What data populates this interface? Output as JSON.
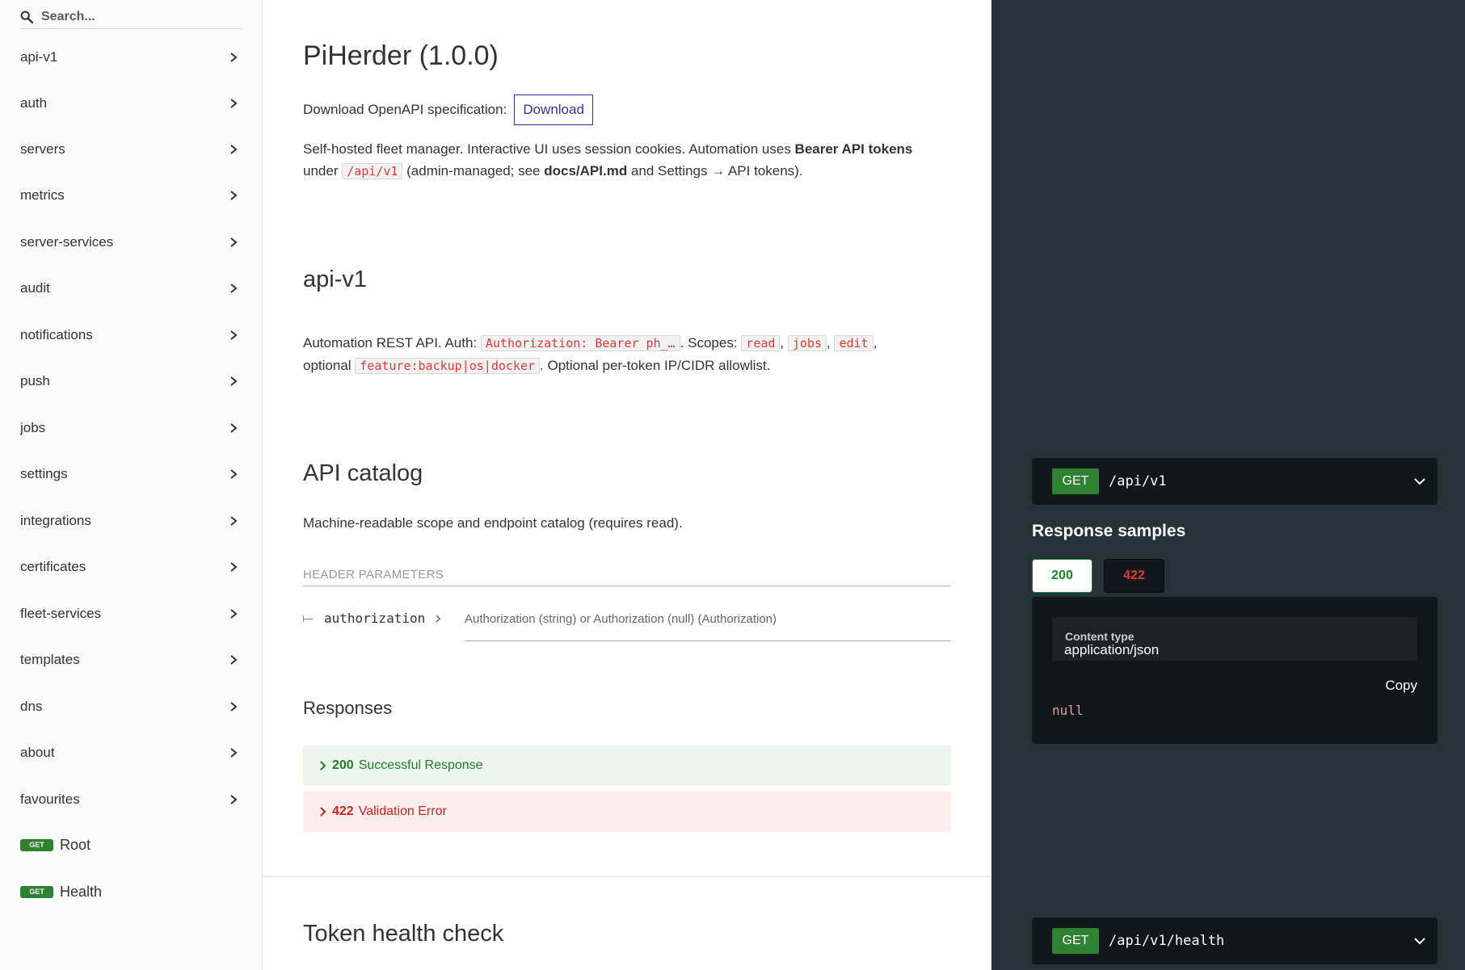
{
  "sidebar": {
    "search_placeholder": "Search...",
    "groups": [
      {
        "label": "api-v1"
      },
      {
        "label": "auth"
      },
      {
        "label": "servers"
      },
      {
        "label": "metrics"
      },
      {
        "label": "server-services"
      },
      {
        "label": "audit"
      },
      {
        "label": "notifications"
      },
      {
        "label": "push"
      },
      {
        "label": "jobs"
      },
      {
        "label": "settings"
      },
      {
        "label": "integrations"
      },
      {
        "label": "certificates"
      },
      {
        "label": "fleet-services"
      },
      {
        "label": "templates"
      },
      {
        "label": "dns"
      },
      {
        "label": "about"
      },
      {
        "label": "favourites"
      }
    ],
    "operations": [
      {
        "method": "GET",
        "label": "Root"
      },
      {
        "method": "GET",
        "label": "Health"
      }
    ]
  },
  "main": {
    "title": "PiHerder (1.0.0)",
    "download_label": "Download OpenAPI specification:",
    "download_button": "Download",
    "intro": {
      "t1": "Self-hosted fleet manager. Interactive UI uses session cookies. Automation uses ",
      "bold1": "Bearer API tokens",
      "t2": " under ",
      "code1": "/api/v1",
      "t3": " (admin-managed; see ",
      "bold2": "docs/API.md",
      "t4": " and Settings → API tokens)."
    },
    "section_title": "api-v1",
    "section_desc": {
      "t1": "Automation REST API. Auth: ",
      "code_auth": "Authorization: Bearer ph_…",
      "t2": ". Scopes: ",
      "code_read": "read",
      "sep1": ", ",
      "code_jobs": "jobs",
      "sep2": ", ",
      "code_edit": "edit",
      "t3": ",",
      "t4": "optional ",
      "code_feature": "feature:backup|os|docker",
      "t5": ". Optional per-token IP/CIDR allowlist."
    },
    "catalog": {
      "title": "API catalog",
      "description": "Machine-readable scope and endpoint catalog (requires read).",
      "header_params": "Header Parameters",
      "param_name": "authorization",
      "param_desc": "Authorization (string) or Authorization (null) (Authorization)",
      "responses_title": "Responses",
      "responses": [
        {
          "code": "200",
          "label": "Successful Response"
        },
        {
          "code": "422",
          "label": "Validation Error"
        }
      ]
    },
    "next_title": "Token health check"
  },
  "right": {
    "op1": {
      "method": "GET",
      "path": "/api/v1"
    },
    "samples_title": "Response samples",
    "tabs": [
      {
        "label": "200"
      },
      {
        "label": "422"
      }
    ],
    "content_type_label": "Content type",
    "content_type_value": "application/json",
    "copy_label": "Copy",
    "sample_value": "null",
    "op2": {
      "method": "GET",
      "path": "/api/v1/health"
    }
  },
  "colors": {
    "get_badge": "#2f8132",
    "success": "#1d8127",
    "error": "#d41f1c",
    "code_red": "#e53935",
    "right_panel": "#263238",
    "download_blue": "#32329f"
  }
}
